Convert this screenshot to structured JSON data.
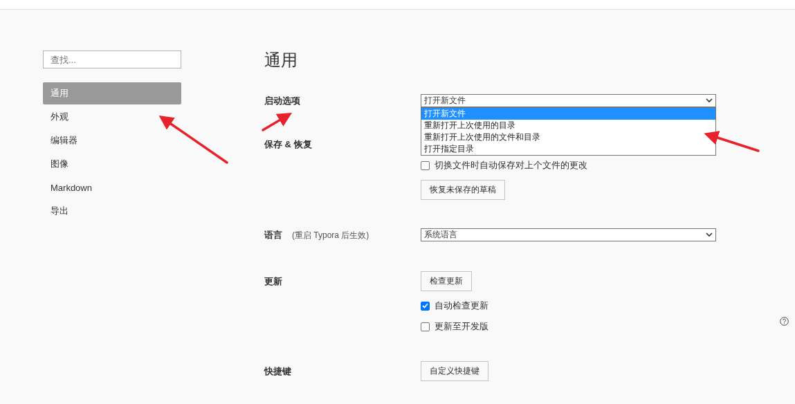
{
  "sidebar": {
    "search": {
      "placeholder": "查找..."
    },
    "items": [
      {
        "label": "通用",
        "selected": true
      },
      {
        "label": "外观",
        "selected": false
      },
      {
        "label": "编辑器",
        "selected": false
      },
      {
        "label": "图像",
        "selected": false
      },
      {
        "label": "Markdown",
        "selected": false
      },
      {
        "label": "导出",
        "selected": false
      }
    ]
  },
  "page": {
    "title": "通用"
  },
  "sections": [
    {
      "label": "启动选项",
      "controls": [
        {
          "kind": "select",
          "value": "打开新文件",
          "expanded": true,
          "options": [
            {
              "label": "打开新文件",
              "selected": true
            },
            {
              "label": "重新打开上次使用的目录",
              "selected": false
            },
            {
              "label": "重新打开上次使用的文件和目录",
              "selected": false
            },
            {
              "label": "打开指定目录",
              "selected": false
            }
          ]
        }
      ]
    },
    {
      "label": "保存 & 恢复",
      "controls": [
        {
          "kind": "checkbox",
          "label": "切换文件时自动保存对上个文件的更改",
          "checked": false
        },
        {
          "kind": "button",
          "label": "恢复未保存的草稿"
        }
      ]
    },
    {
      "label": "语言",
      "note": "(重启 Typora 后生效)",
      "controls": [
        {
          "kind": "select",
          "value": "系统语言",
          "expanded": false
        }
      ]
    },
    {
      "label": "更新",
      "controls": [
        {
          "kind": "button",
          "label": "检查更新"
        },
        {
          "kind": "checkbox",
          "label": "自动检查更新",
          "checked": true
        },
        {
          "kind": "checkbox",
          "label": "更新至开发版",
          "checked": false
        }
      ]
    },
    {
      "label": "快捷键",
      "controls": [
        {
          "kind": "button",
          "label": "自定义快捷键"
        }
      ]
    }
  ]
}
